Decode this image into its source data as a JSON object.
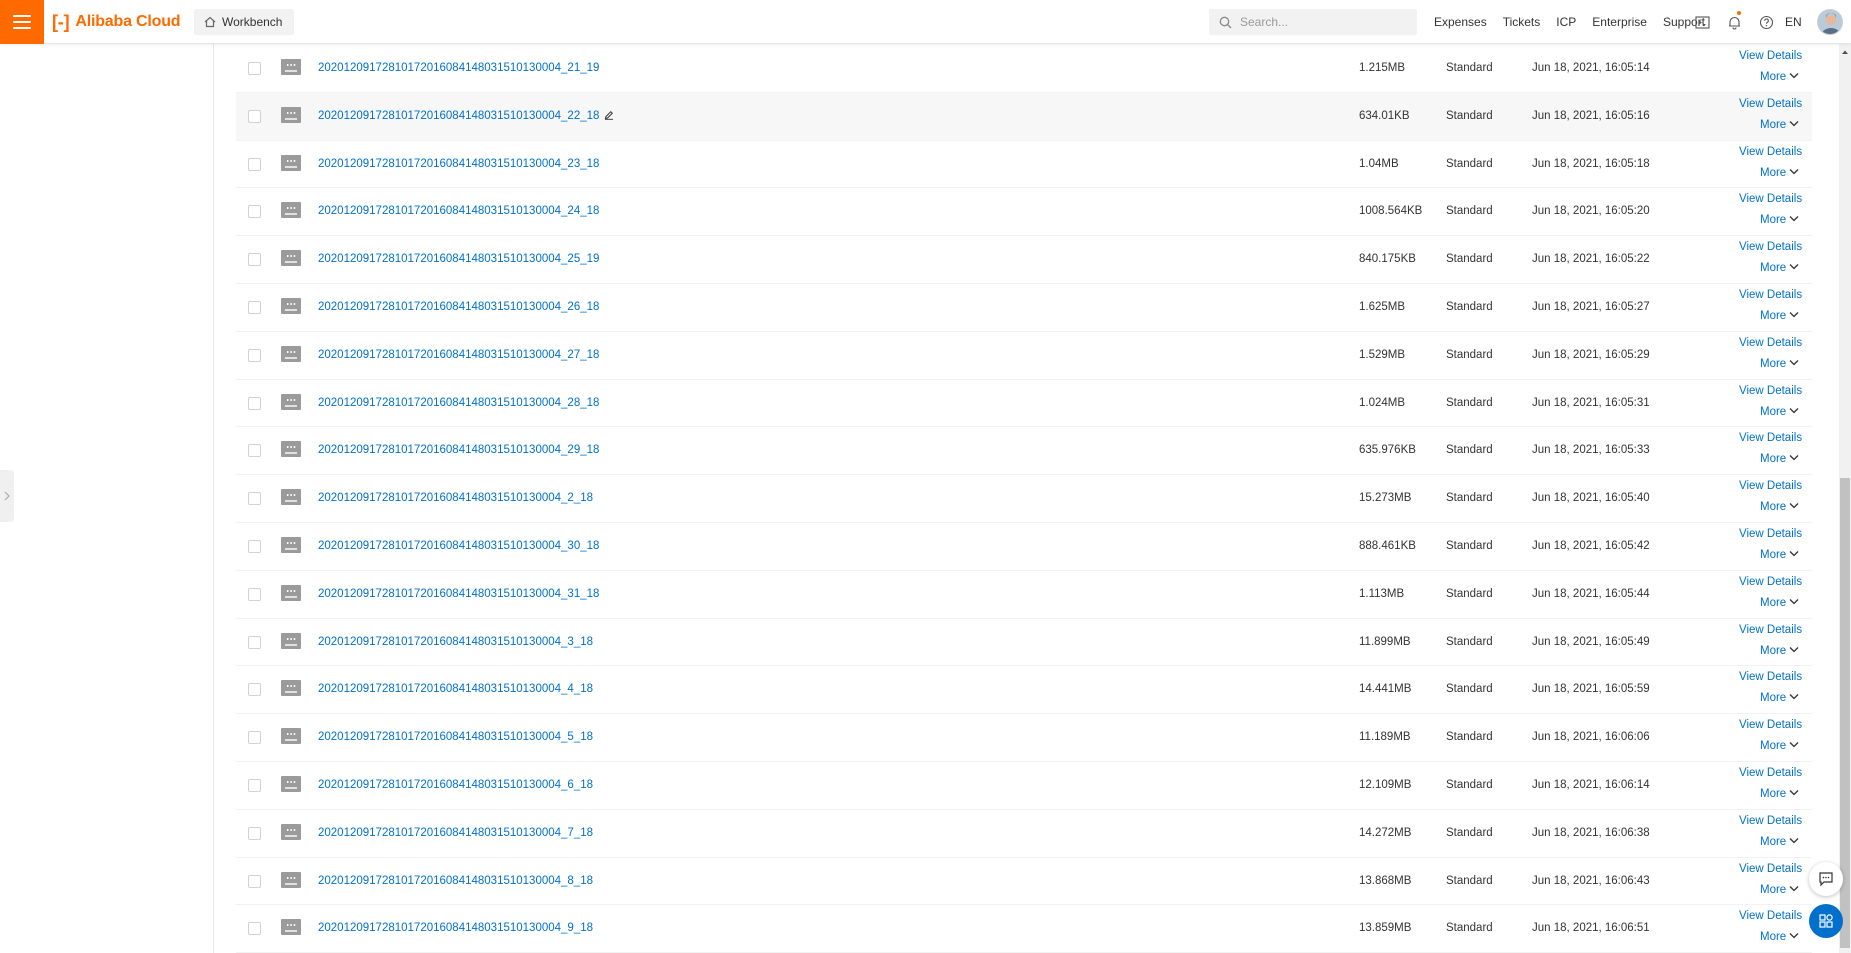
{
  "header": {
    "logo_text": "Alibaba Cloud",
    "workbench_label": "Workbench",
    "search_placeholder": "Search...",
    "nav_links": [
      "Expenses",
      "Tickets",
      "ICP",
      "Enterprise",
      "Support"
    ],
    "lang": "EN",
    "accent_color": "#ff6a00"
  },
  "table": {
    "link_color": "#0070cc",
    "row_action_view": "View Details",
    "row_action_more": "More",
    "rows": [
      {
        "name": "20201209172810172016084148031510130004_21_19",
        "size": "1.215MB",
        "storage": "Standard",
        "time": "Jun 18, 2021, 16:05:14"
      },
      {
        "name": "20201209172810172016084148031510130004_22_18",
        "size": "634.01KB",
        "storage": "Standard",
        "time": "Jun 18, 2021, 16:05:16"
      },
      {
        "name": "20201209172810172016084148031510130004_23_18",
        "size": "1.04MB",
        "storage": "Standard",
        "time": "Jun 18, 2021, 16:05:18"
      },
      {
        "name": "20201209172810172016084148031510130004_24_18",
        "size": "1008.564KB",
        "storage": "Standard",
        "time": "Jun 18, 2021, 16:05:20"
      },
      {
        "name": "20201209172810172016084148031510130004_25_19",
        "size": "840.175KB",
        "storage": "Standard",
        "time": "Jun 18, 2021, 16:05:22"
      },
      {
        "name": "20201209172810172016084148031510130004_26_18",
        "size": "1.625MB",
        "storage": "Standard",
        "time": "Jun 18, 2021, 16:05:27"
      },
      {
        "name": "20201209172810172016084148031510130004_27_18",
        "size": "1.529MB",
        "storage": "Standard",
        "time": "Jun 18, 2021, 16:05:29"
      },
      {
        "name": "20201209172810172016084148031510130004_28_18",
        "size": "1.024MB",
        "storage": "Standard",
        "time": "Jun 18, 2021, 16:05:31"
      },
      {
        "name": "20201209172810172016084148031510130004_29_18",
        "size": "635.976KB",
        "storage": "Standard",
        "time": "Jun 18, 2021, 16:05:33"
      },
      {
        "name": "20201209172810172016084148031510130004_2_18",
        "size": "15.273MB",
        "storage": "Standard",
        "time": "Jun 18, 2021, 16:05:40"
      },
      {
        "name": "20201209172810172016084148031510130004_30_18",
        "size": "888.461KB",
        "storage": "Standard",
        "time": "Jun 18, 2021, 16:05:42"
      },
      {
        "name": "20201209172810172016084148031510130004_31_18",
        "size": "1.113MB",
        "storage": "Standard",
        "time": "Jun 18, 2021, 16:05:44"
      },
      {
        "name": "20201209172810172016084148031510130004_3_18",
        "size": "11.899MB",
        "storage": "Standard",
        "time": "Jun 18, 2021, 16:05:49"
      },
      {
        "name": "20201209172810172016084148031510130004_4_18",
        "size": "14.441MB",
        "storage": "Standard",
        "time": "Jun 18, 2021, 16:05:59"
      },
      {
        "name": "20201209172810172016084148031510130004_5_18",
        "size": "11.189MB",
        "storage": "Standard",
        "time": "Jun 18, 2021, 16:06:06"
      },
      {
        "name": "20201209172810172016084148031510130004_6_18",
        "size": "12.109MB",
        "storage": "Standard",
        "time": "Jun 18, 2021, 16:06:14"
      },
      {
        "name": "20201209172810172016084148031510130004_7_18",
        "size": "14.272MB",
        "storage": "Standard",
        "time": "Jun 18, 2021, 16:06:38"
      },
      {
        "name": "20201209172810172016084148031510130004_8_18",
        "size": "13.868MB",
        "storage": "Standard",
        "time": "Jun 18, 2021, 16:06:43"
      },
      {
        "name": "20201209172810172016084148031510130004_9_18",
        "size": "13.859MB",
        "storage": "Standard",
        "time": "Jun 18, 2021, 16:06:51"
      }
    ]
  },
  "icons": {
    "menu": "hamburger-menu-icon",
    "home": "home-icon",
    "search": "search-icon",
    "terminal": "terminal-icon",
    "bell": "bell-icon",
    "help": "help-icon",
    "edit": "edit-icon",
    "chevron": "chevron-down-icon",
    "file": "image-file-icon",
    "chat": "chat-icon",
    "apps": "apps-grid-icon"
  }
}
